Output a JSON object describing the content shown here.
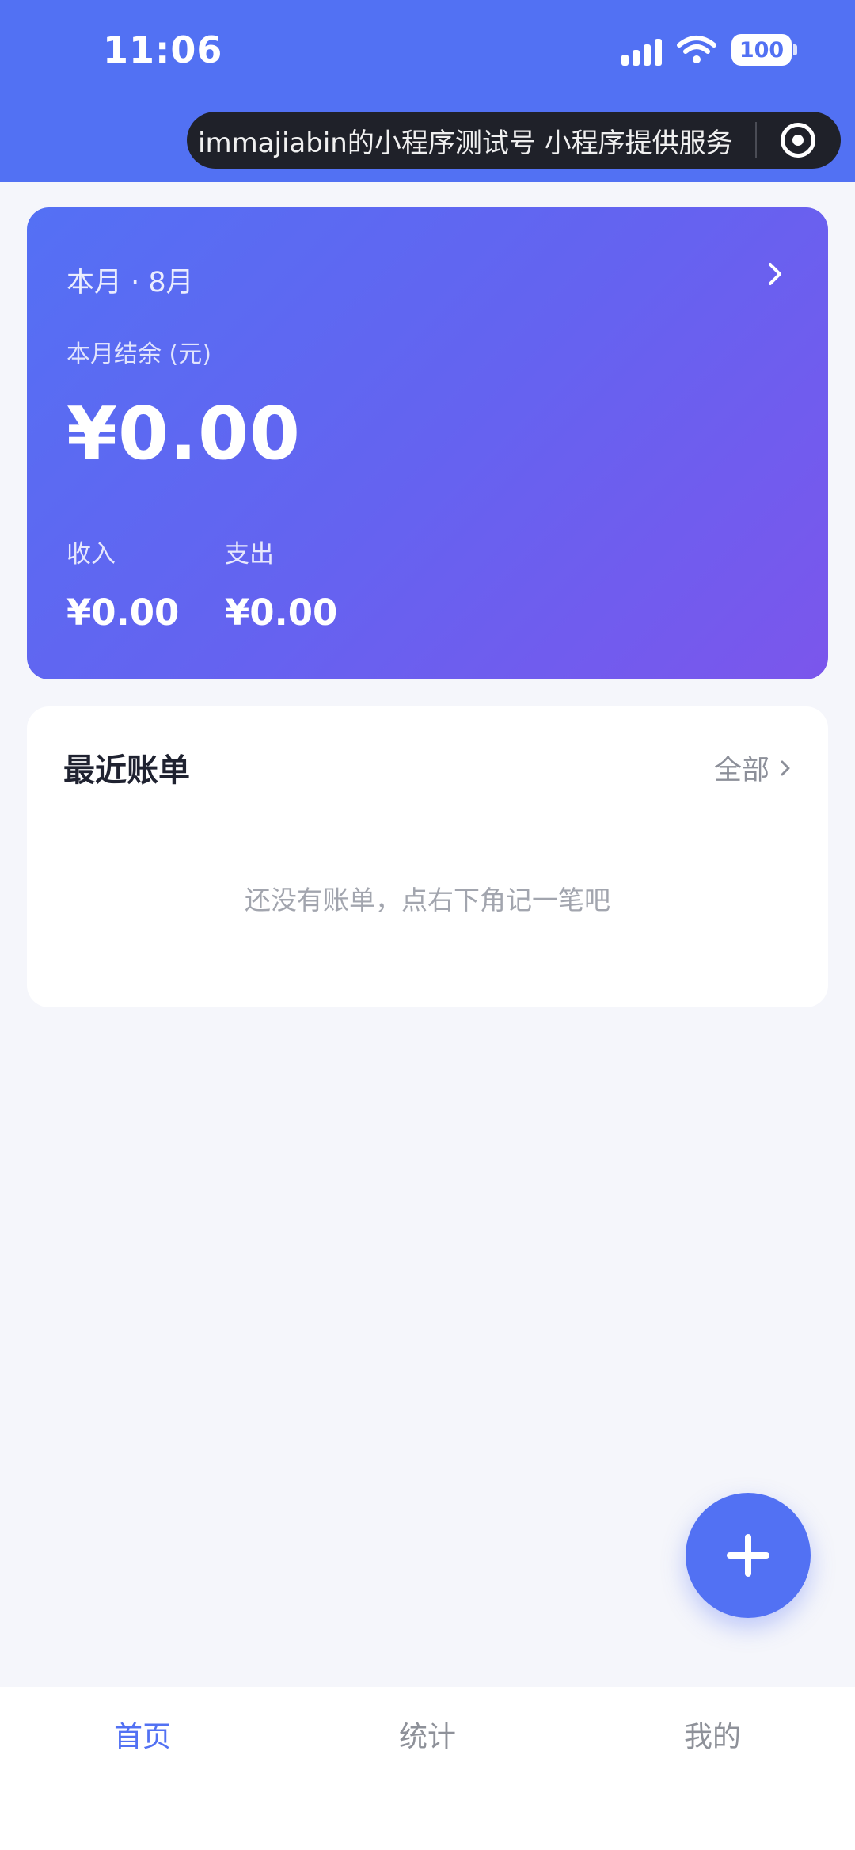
{
  "status_bar": {
    "time": "11:06",
    "battery": "100"
  },
  "capsule": {
    "text": "immajiabin的小程序测试号 小程序提供服务"
  },
  "summary": {
    "month_label": "本月 · 8月",
    "balance_label": "本月结余 (元)",
    "balance": "¥0.00",
    "income_label": "收入",
    "income_value": "¥0.00",
    "expense_label": "支出",
    "expense_value": "¥0.00"
  },
  "recent_bills": {
    "title": "最近账单",
    "all_label": "全部",
    "empty_text": "还没有账单，点右下角记一笔吧"
  },
  "tabs": [
    {
      "label": "首页",
      "active": true
    },
    {
      "label": "统计",
      "active": false
    },
    {
      "label": "我的",
      "active": false
    }
  ],
  "colors": {
    "primary": "#5271f3",
    "gradient_start": "#5470f4",
    "gradient_end": "#7b56ec",
    "background": "#f5f6fb"
  },
  "icons": {
    "fab": "plus-icon",
    "card_arrow": "chevron-right-icon",
    "capsule": "target-icon"
  }
}
